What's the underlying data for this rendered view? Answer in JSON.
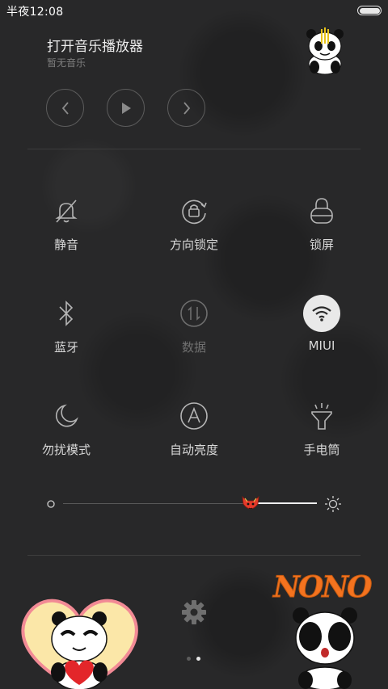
{
  "status_bar": {
    "time": "半夜12:08",
    "battery_level": 1.0
  },
  "music": {
    "title": "打开音乐播放器",
    "subtitle": "暂无音乐",
    "controls": [
      "previous-icon",
      "play-icon",
      "next-icon"
    ]
  },
  "toggles": [
    {
      "label": "静音",
      "icon": "bell-off-icon",
      "active": false,
      "enabled": true
    },
    {
      "label": "方向锁定",
      "icon": "rotation-lock-icon",
      "active": false,
      "enabled": true
    },
    {
      "label": "锁屏",
      "icon": "lock-icon",
      "active": false,
      "enabled": true
    },
    {
      "label": "蓝牙",
      "icon": "bluetooth-icon",
      "active": false,
      "enabled": true
    },
    {
      "label": "数据",
      "icon": "mobile-data-icon",
      "active": false,
      "enabled": false
    },
    {
      "label": "MIUI",
      "icon": "wifi-icon",
      "active": true,
      "enabled": true
    },
    {
      "label": "勿扰模式",
      "icon": "moon-icon",
      "active": false,
      "enabled": true
    },
    {
      "label": "自动亮度",
      "icon": "auto-brightness-icon",
      "active": false,
      "enabled": true
    },
    {
      "label": "手电筒",
      "icon": "flashlight-icon",
      "active": false,
      "enabled": true
    }
  ],
  "brightness": {
    "level": 0.74
  },
  "sticker_text": {
    "nono": "NONO"
  },
  "pager": {
    "count": 2,
    "current": 1
  },
  "colors": {
    "background": "#282829",
    "text": "#d8d8d8",
    "disabled_text": "#707070",
    "active_toggle": "#e9e9e9",
    "sticker_orange": "#f4731f"
  }
}
